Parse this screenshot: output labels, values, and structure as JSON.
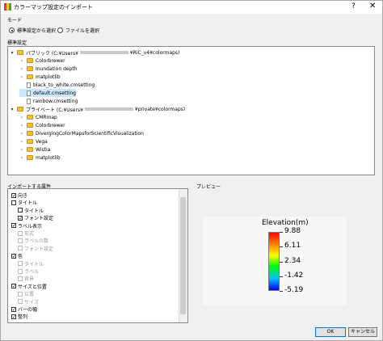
{
  "title": "カラーマップ設定のインポート",
  "title_bar": {
    "help": "?",
    "close": "✕"
  },
  "mode": {
    "label": "モード",
    "options": [
      {
        "label": "標準設定から選択",
        "selected": true
      },
      {
        "label": "ファイルを選択",
        "selected": false
      }
    ]
  },
  "standard": {
    "label": "標準設定",
    "public_prefix": "パブリック (C:¥Users¥",
    "public_suffix": "¥RiC_v4¥colormaps)",
    "public_items": [
      "Colorbrewer",
      "Inundation depth",
      "matplotlib",
      "black_to_white.cmsetting",
      "default.cmsetting",
      "rainbow.cmsetting"
    ],
    "private_prefix": "プライベート (C:¥Users¥",
    "private_suffix": "¥private¥colormaps)",
    "private_items": [
      "CMRmap",
      "Colorbrewer",
      "DivergingColorMapsforScientificVisualization",
      "Vega",
      "Wistia",
      "matplotlib"
    ]
  },
  "attributes": {
    "label": "インポートする属性",
    "items": [
      {
        "label": "向き",
        "checked": true,
        "enabled": true,
        "indent": 0
      },
      {
        "label": "タイトル",
        "checked": false,
        "enabled": true,
        "indent": 0
      },
      {
        "label": "タイトル",
        "checked": false,
        "enabled": true,
        "indent": 1
      },
      {
        "label": "フォント設定",
        "checked": true,
        "enabled": true,
        "indent": 1
      },
      {
        "label": "ラベル表示",
        "checked": true,
        "enabled": true,
        "indent": 0
      },
      {
        "label": "形式",
        "checked": false,
        "enabled": false,
        "indent": 1
      },
      {
        "label": "ラベルの数",
        "checked": false,
        "enabled": false,
        "indent": 1
      },
      {
        "label": "フォント設定",
        "checked": false,
        "enabled": false,
        "indent": 1
      },
      {
        "label": "色",
        "checked": true,
        "enabled": true,
        "indent": 0
      },
      {
        "label": "タイトル",
        "checked": false,
        "enabled": false,
        "indent": 1
      },
      {
        "label": "ラベル",
        "checked": false,
        "enabled": false,
        "indent": 1
      },
      {
        "label": "背景",
        "checked": false,
        "enabled": false,
        "indent": 1
      },
      {
        "label": "サイズと位置",
        "checked": true,
        "enabled": true,
        "indent": 0
      },
      {
        "label": "位置",
        "checked": false,
        "enabled": false,
        "indent": 1
      },
      {
        "label": "サイズ",
        "checked": false,
        "enabled": false,
        "indent": 1
      },
      {
        "label": "バーの幅",
        "checked": true,
        "enabled": true,
        "indent": 0
      },
      {
        "label": "整列",
        "checked": true,
        "enabled": true,
        "indent": 0
      }
    ]
  },
  "preview": {
    "label": "プレビュー",
    "legend_title": "Elevation(m)",
    "ticks": [
      "9.88",
      "6.11",
      "2.34",
      "-1.42",
      "-5.19"
    ]
  },
  "buttons": {
    "ok": "OK",
    "cancel": "キャンセル"
  }
}
